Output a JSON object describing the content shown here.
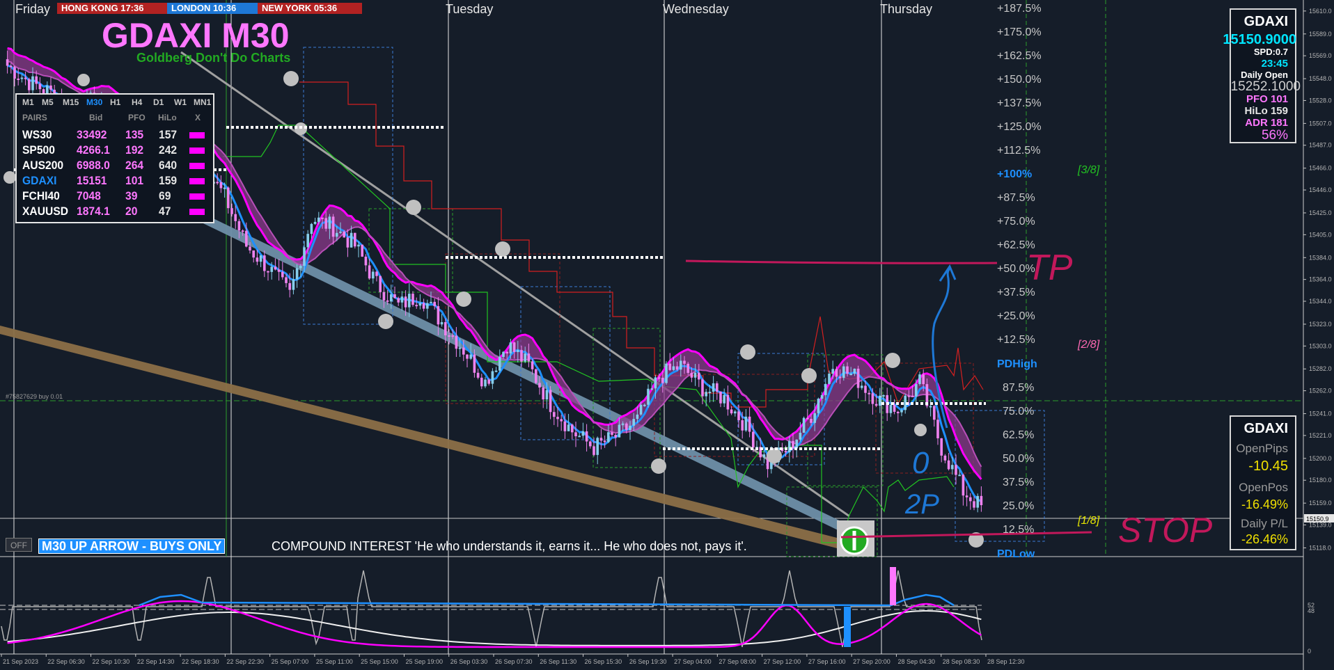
{
  "chart_title": "GDAXI M30",
  "chart_subtitle": "Goldberg Don't Do Charts",
  "sessions": [
    {
      "label": "HONG KONG 17:36",
      "color": "#b22222"
    },
    {
      "label": "LONDON  10:36",
      "color": "#1e78d6"
    },
    {
      "label": "NEW YORK  05:36",
      "color": "#b22222"
    }
  ],
  "day_labels": [
    "Friday",
    "Tuesday",
    "Wednesday",
    "Thursday"
  ],
  "pairs_table": {
    "timeframes": [
      "M1",
      "M5",
      "M15",
      "M30",
      "H1",
      "H4",
      "D1",
      "W1",
      "MN1"
    ],
    "active_timeframe": "M30",
    "headers": [
      "PAIRS",
      "Bid",
      "PFO",
      "HiLo",
      "X"
    ],
    "rows": [
      {
        "pair": "WS30",
        "bid": "33492",
        "pfo": "135",
        "hilo": "157",
        "color": "#ffffff"
      },
      {
        "pair": "SP500",
        "bid": "4266.1",
        "pfo": "192",
        "hilo": "242",
        "color": "#ffffff"
      },
      {
        "pair": "AUS200",
        "bid": "6988.0",
        "pfo": "264",
        "hilo": "640",
        "color": "#ffffff"
      },
      {
        "pair": "GDAXI",
        "bid": "15151",
        "pfo": "101",
        "hilo": "159",
        "color": "#1e90ff"
      },
      {
        "pair": "FCHI40",
        "bid": "7048",
        "pfo": "39",
        "hilo": "69",
        "color": "#ffffff"
      },
      {
        "pair": "XAUUSD",
        "bid": "1874.1",
        "pfo": "20",
        "hilo": "47",
        "color": "#ffffff"
      }
    ]
  },
  "info_box_top": {
    "symbol": "GDAXI",
    "price": "15150.9000",
    "spread": "SPD:0.7",
    "time": "23:45",
    "daily_open_label": "Daily Open",
    "daily_open": "15252.1000",
    "pfo": "PFO 101",
    "hilo": "HiLo 159",
    "adr": "ADR 181",
    "adr_pct": "56%"
  },
  "info_box_bottom": {
    "symbol": "GDAXI",
    "open_pips_label": "OpenPips",
    "open_pips": "-10.45",
    "open_pos_label": "OpenPos",
    "open_pos": "-16.49%",
    "daily_pl_label": "Daily P/L",
    "daily_pl": "-26.46%"
  },
  "fib_levels": [
    "+187.5%",
    "+175.0%",
    "+162.5%",
    "+150.0%",
    "+137.5%",
    "+125.0%",
    "+112.5%",
    "+100%",
    "+87.5%",
    "+75.0%",
    "+62.5%",
    "+50.0%",
    "+37.5%",
    "+25.0%",
    "+12.5%",
    "PDHigh",
    "87.5%",
    "75.0%",
    "62.5%",
    "50.0%",
    "37.5%",
    "25.0%",
    "12.5%",
    "PDLow"
  ],
  "murrey_labels": [
    "[3/8]",
    "[2/8]",
    "[1/8]"
  ],
  "order_label": "#75827629 buy 0.01",
  "current_price_tag": "15150.9",
  "annotations": {
    "tp": "TP",
    "stop": "STOP",
    "zero": "0",
    "two_p": "2P"
  },
  "banner": {
    "off_button": "OFF",
    "label": "M30  UP ARROW - BUYS ONLY",
    "text": "COMPOUND INTEREST  'He who understands it, earns it... He who does not, pays it'."
  },
  "osc_axis": [
    "52",
    "48",
    "0"
  ],
  "colors": {
    "background": "#151d29",
    "bull": "#87ceeb",
    "bear": "#ee82ee",
    "ribbon": "#8b3a8b",
    "magenta": "#ff00ff"
  },
  "chart_data": {
    "type": "candlestick",
    "symbol": "GDAXI",
    "timeframe": "M30",
    "x_labels": [
      "21 Sep 2023",
      "22 Sep 06:30",
      "22 Sep 10:30",
      "22 Sep 14:30",
      "22 Sep 18:30",
      "22 Sep 22:30",
      "25 Sep 07:00",
      "25 Sep 11:00",
      "25 Sep 15:00",
      "25 Sep 19:00",
      "26 Sep 03:30",
      "26 Sep 07:30",
      "26 Sep 11:30",
      "26 Sep 15:30",
      "26 Sep 19:30",
      "27 Sep 04:00",
      "27 Sep 08:00",
      "27 Sep 12:00",
      "27 Sep 16:00",
      "27 Sep 20:00",
      "28 Sep 04:30",
      "28 Sep 08:30",
      "28 Sep 12:30"
    ],
    "y_ticks": [
      15610.0,
      15589.0,
      15569.0,
      15548.0,
      15528.0,
      15507.0,
      15487.0,
      15466.0,
      15446.0,
      15425.0,
      15405.0,
      15384.0,
      15364.0,
      15344.0,
      15323.0,
      15303.0,
      15282.0,
      15262.0,
      15241.0,
      15221.0,
      15200.0,
      15180.0,
      15159.0,
      15139.0,
      15118.0
    ],
    "ylim": [
      15110,
      15615
    ],
    "current_price": 15150.9,
    "close_path": [
      15560,
      15545,
      15535,
      15520,
      15528,
      15512,
      15500,
      15490,
      15505,
      15470,
      15440,
      15395,
      15375,
      15350,
      15420,
      15412,
      15395,
      15360,
      15340,
      15350,
      15325,
      15300,
      15270,
      15305,
      15285,
      15250,
      15225,
      15210,
      15220,
      15235,
      15275,
      15285,
      15265,
      15255,
      15230,
      15195,
      15210,
      15240,
      15285,
      15275,
      15255,
      15245,
      15270,
      15210,
      15170,
      15152
    ]
  }
}
